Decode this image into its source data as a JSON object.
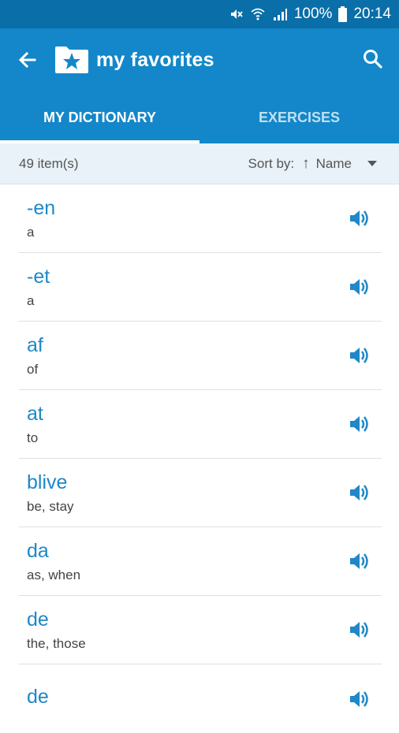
{
  "status": {
    "battery": "100%",
    "time": "20:14"
  },
  "header": {
    "title": "my favorites"
  },
  "tabs": [
    {
      "label": "MY DICTIONARY",
      "active": true
    },
    {
      "label": "EXERCISES",
      "active": false
    }
  ],
  "sortbar": {
    "count": "49 item(s)",
    "sort_label": "Sort by:",
    "sort_arrow": "↑",
    "sort_value": "Name"
  },
  "entries": [
    {
      "word": "-en",
      "translation": "a"
    },
    {
      "word": "-et",
      "translation": "a"
    },
    {
      "word": "af",
      "translation": "of"
    },
    {
      "word": "at",
      "translation": "to"
    },
    {
      "word": "blive",
      "translation": "be, stay"
    },
    {
      "word": "da",
      "translation": "as, when"
    },
    {
      "word": "de",
      "translation": "the, those"
    },
    {
      "word": "de",
      "translation": ""
    }
  ],
  "colors": {
    "statusbar": "#0a6ea8",
    "appbar": "#1387c9",
    "accent": "#1e88c8",
    "sortbar": "#e8f2f8"
  },
  "icons": {
    "back": "arrow-left-icon",
    "title": "folder-star-icon",
    "search": "search-icon",
    "speaker": "speaker-icon"
  }
}
